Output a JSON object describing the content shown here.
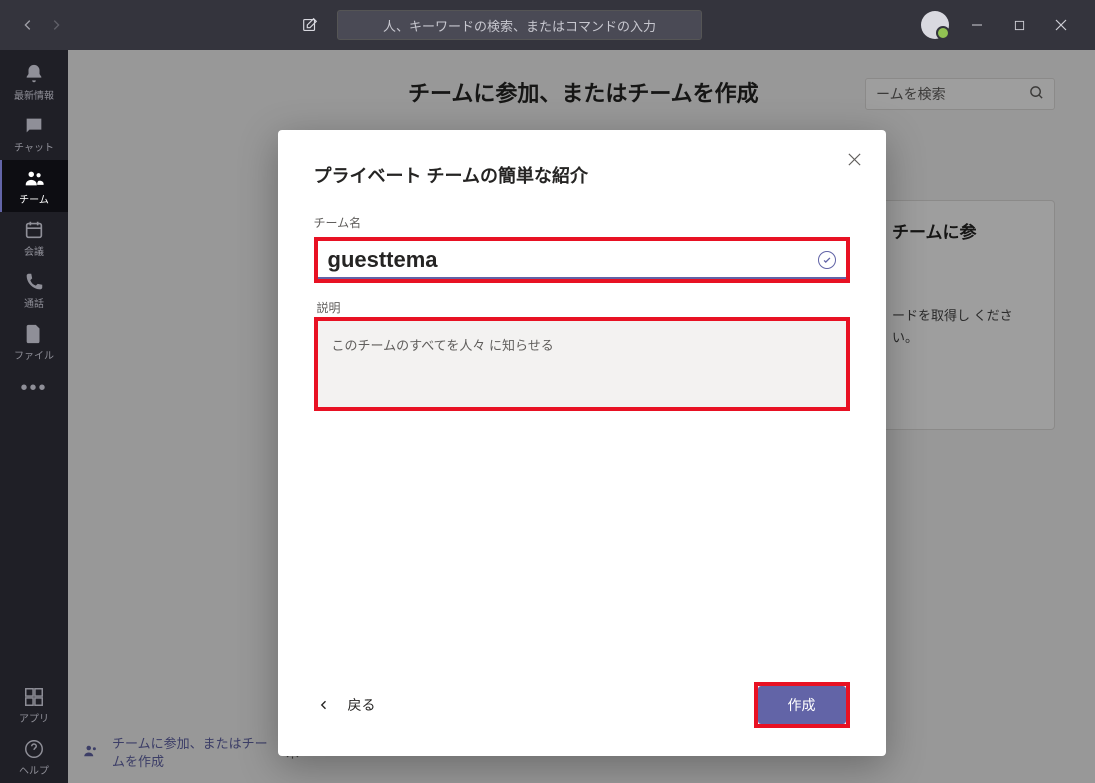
{
  "titlebar": {
    "search_placeholder": "人、キーワードの検索、またはコマンドの入力"
  },
  "rail": {
    "items": [
      {
        "label": "最新情報",
        "icon": "bell"
      },
      {
        "label": "チャット",
        "icon": "chat"
      },
      {
        "label": "チーム",
        "icon": "team"
      },
      {
        "label": "会議",
        "icon": "calendar"
      },
      {
        "label": "通話",
        "icon": "phone"
      },
      {
        "label": "ファイル",
        "icon": "file"
      }
    ],
    "apps_label": "アプリ",
    "help_label": "ヘルプ"
  },
  "page": {
    "title_partial": "チームに参加、またはチームを作成",
    "search_teams_placeholder": "ームを検索",
    "card_title": "チームに参",
    "card_body": "ードを取得し\nください。"
  },
  "bottom": {
    "text": "チームに参加、またはチームを作成"
  },
  "modal": {
    "title": "プライベート チームの簡単な紹介",
    "team_name_label": "チーム名",
    "team_name_value": "guesttema",
    "description_label": "説明",
    "description_placeholder": "このチームのすべてを人々 に知らせる",
    "back_label": "戻る",
    "create_label": "作成"
  }
}
